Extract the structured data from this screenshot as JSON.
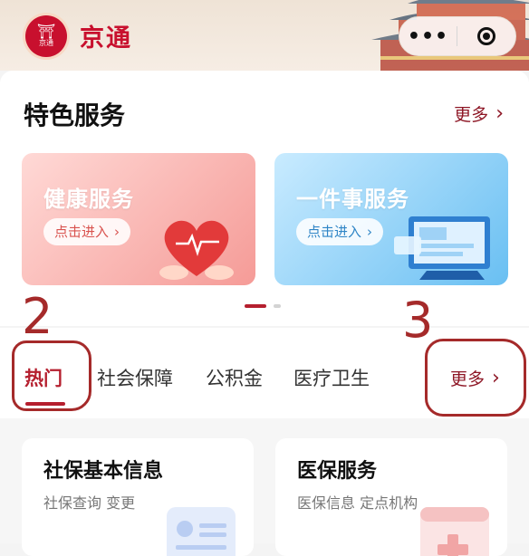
{
  "header": {
    "logo_text": "京通",
    "title": "京通",
    "more_glyph": "•••",
    "close_icon": "target-icon"
  },
  "featured": {
    "title": "特色服务",
    "more_label": "更多",
    "cards": [
      {
        "title": "健康服务",
        "button": "点击进入",
        "icon": "heart-pulse-icon"
      },
      {
        "title": "一件事服务",
        "button": "点击进入",
        "icon": "computer-screen-icon"
      }
    ]
  },
  "tabs": {
    "items": [
      "热门",
      "社会保障",
      "公积金",
      "医疗卫生"
    ],
    "active": "热门",
    "more_label": "更多"
  },
  "annotations": [
    "2",
    "3"
  ],
  "services": [
    {
      "title": "社保基本信息",
      "subtitle": "社保查询 变更"
    },
    {
      "title": "医保服务",
      "subtitle": "医保信息 定点机构"
    }
  ],
  "colors": {
    "brand": "#c8102e",
    "accent": "#8e1726",
    "annotation": "#a52a2a"
  }
}
